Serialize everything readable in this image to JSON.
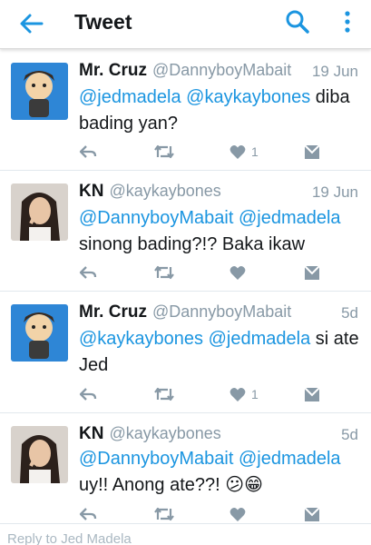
{
  "appbar": {
    "title": "Tweet",
    "back_icon": "arrow-left-icon",
    "search_icon": "search-icon",
    "more_icon": "overflow-menu-icon",
    "accent": "#1b95e0"
  },
  "tweets": [
    {
      "name": "Mr. Cruz",
      "handle": "@DannyboyMabait",
      "time": "19 Jun",
      "text_parts": [
        {
          "t": "@jedmadela",
          "m": true
        },
        {
          "t": " ",
          "m": false
        },
        {
          "t": "@kaykaybones",
          "m": true
        },
        {
          "t": " diba bading yan?",
          "m": false
        }
      ],
      "likes": "1"
    },
    {
      "name": "KN",
      "handle": "@kaykaybones",
      "time": "19 Jun",
      "text_parts": [
        {
          "t": "@DannyboyMabait",
          "m": true
        },
        {
          "t": " ",
          "m": false
        },
        {
          "t": "@jedmadela",
          "m": true
        },
        {
          "t": " sinong bading?!? Baka ikaw",
          "m": false
        }
      ],
      "likes": ""
    },
    {
      "name": "Mr. Cruz",
      "handle": "@DannyboyMabait",
      "time": "5d",
      "text_parts": [
        {
          "t": "@kaykaybones",
          "m": true
        },
        {
          "t": " ",
          "m": false
        },
        {
          "t": "@jedmadela",
          "m": true
        },
        {
          "t": " si ate Jed",
          "m": false
        }
      ],
      "likes": "1"
    },
    {
      "name": "KN",
      "handle": "@kaykaybones",
      "time": "5d",
      "text_parts": [
        {
          "t": "@DannyboyMabait",
          "m": true
        },
        {
          "t": " ",
          "m": false
        },
        {
          "t": "@jedmadela",
          "m": true
        },
        {
          "t": " uy!! Anong ate??! 😕😁",
          "m": false
        }
      ],
      "likes": ""
    }
  ],
  "footer_text": "Reply to Jed Madela"
}
